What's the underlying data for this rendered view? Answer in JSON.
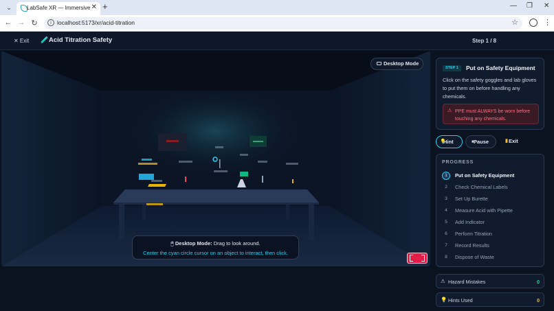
{
  "browser": {
    "tab_title": "LabSafe XR — Immersive Lab S",
    "tab_close": "✕",
    "new_tab": "+",
    "url": "localhost:5173/xr/acid-titration",
    "minimize": "—",
    "restore": "❐",
    "close": "✕"
  },
  "header": {
    "exit_label": "✕ Exit",
    "title": "Acid Titration Safety",
    "step_counter": "Step 1 / 8"
  },
  "viewport": {
    "mode_button": "Desktop Mode",
    "info_title": "Desktop Mode:",
    "info_text": "Drag to look around.",
    "info_hint": "Center the cyan circle cursor on an object to interact, then click."
  },
  "step": {
    "badge": "STEP 1",
    "title": "Put on Safety Equipment",
    "description": "Click on the safety goggles and lab gloves to put them on before handling any chemicals.",
    "warning": "PPE must ALWAYS be worn before touching any chemicals."
  },
  "actions": {
    "hint": "Hint",
    "pause": "Pause",
    "exit": "Exit"
  },
  "progress": {
    "heading": "PROGRESS",
    "steps": [
      {
        "num": "1",
        "label": "Put on Safety Equipment"
      },
      {
        "num": "2",
        "label": "Check Chemical Labels"
      },
      {
        "num": "3",
        "label": "Set Up Burette"
      },
      {
        "num": "4",
        "label": "Measure Acid with Pipette"
      },
      {
        "num": "5",
        "label": "Add Indicator"
      },
      {
        "num": "6",
        "label": "Perform Titration"
      },
      {
        "num": "7",
        "label": "Record Results"
      },
      {
        "num": "8",
        "label": "Dispose of Waste"
      }
    ]
  },
  "stats": {
    "hazard_label": "Hazard Mistakes",
    "hazard_value": "0",
    "hints_label": "Hints Used",
    "hints_value": "0"
  },
  "colors": {
    "accent": "#22d3ee",
    "warning": "#fb7185",
    "success": "#34d399",
    "hints": "#fbbf24"
  }
}
